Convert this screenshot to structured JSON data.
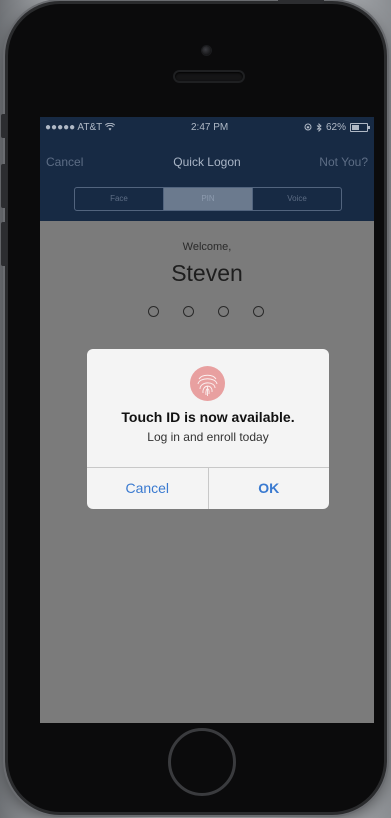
{
  "status_bar": {
    "carrier": "●●●●● AT&T",
    "time": "2:47 PM",
    "battery": "62%",
    "battery_level": 0.62
  },
  "nav": {
    "cancel_label": "Cancel",
    "title": "Quick Logon",
    "not_you_label": "Not You?"
  },
  "segments": [
    {
      "label": "Face"
    },
    {
      "label": "PIN",
      "selected": true
    },
    {
      "label": "Voice"
    }
  ],
  "welcome": {
    "greeting": "Welcome,",
    "name": "Steven",
    "pin_length": 4
  },
  "alert": {
    "icon": "fingerprint-icon",
    "title": "Touch ID is now available.",
    "message": "Log in and enroll today",
    "cancel_label": "Cancel",
    "ok_label": "OK"
  },
  "colors": {
    "nav_background": "#172a44",
    "screen_background": "#7b7b7b",
    "alert_button_text": "#3a7ad0",
    "fingerprint": "#e8a0a0"
  }
}
